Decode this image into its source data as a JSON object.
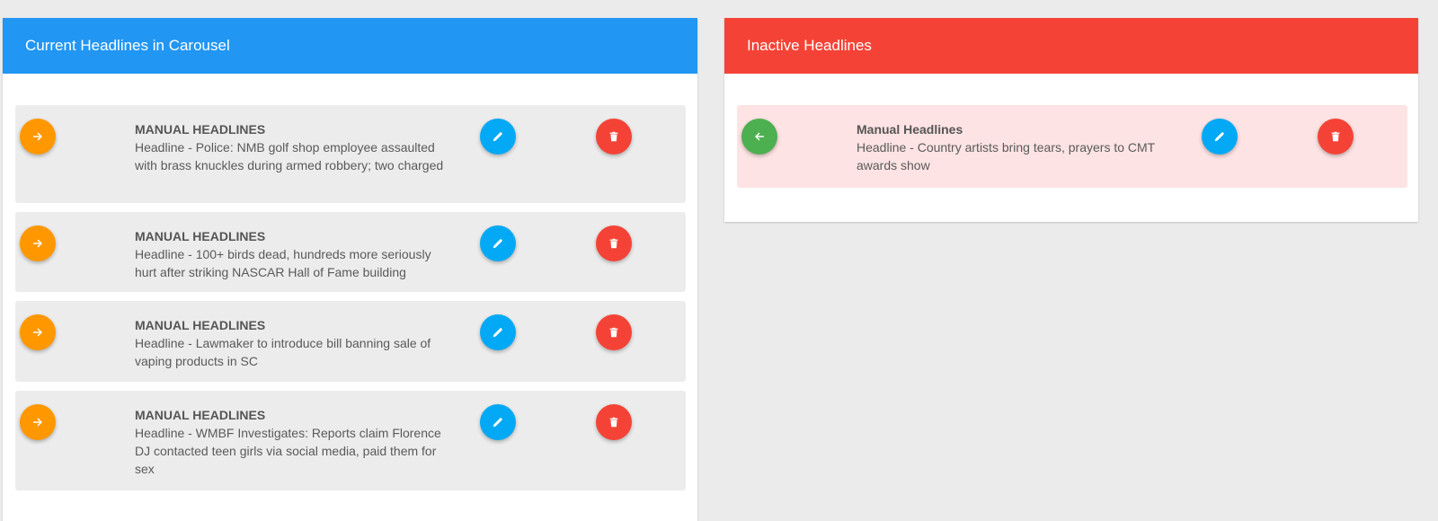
{
  "colors": {
    "active_header": "#2196f3",
    "inactive_header": "#f44336",
    "activate_button": "#ff9800",
    "deactivate_button": "#4caf50",
    "edit_button": "#03a9f4",
    "delete_button": "#f44336"
  },
  "active_panel": {
    "title": "Current Headlines in Carousel",
    "items": [
      {
        "category": "MANUAL HEADLINES",
        "headline": "Headline - Police: NMB golf shop employee assaulted with brass knuckles during armed robbery; two charged",
        "move_icon": "arrow-right-icon",
        "edit_icon": "pencil-icon",
        "delete_icon": "trash-icon"
      },
      {
        "category": "MANUAL HEADLINES",
        "headline": "Headline - 100+ birds dead, hundreds more seriously hurt after striking NASCAR Hall of Fame building",
        "move_icon": "arrow-right-icon",
        "edit_icon": "pencil-icon",
        "delete_icon": "trash-icon"
      },
      {
        "category": "MANUAL HEADLINES",
        "headline": "Headline - Lawmaker to introduce bill banning sale of vaping products in SC",
        "move_icon": "arrow-right-icon",
        "edit_icon": "pencil-icon",
        "delete_icon": "trash-icon"
      },
      {
        "category": "MANUAL HEADLINES",
        "headline": "Headline - WMBF Investigates: Reports claim Florence DJ contacted teen girls via social media, paid them for sex",
        "move_icon": "arrow-right-icon",
        "edit_icon": "pencil-icon",
        "delete_icon": "trash-icon"
      }
    ]
  },
  "inactive_panel": {
    "title": "Inactive Headlines",
    "items": [
      {
        "category": "Manual Headlines",
        "headline": "Headline - Country artists bring tears, prayers to CMT awards show",
        "move_icon": "arrow-left-icon",
        "edit_icon": "pencil-icon",
        "delete_icon": "trash-icon"
      }
    ]
  }
}
